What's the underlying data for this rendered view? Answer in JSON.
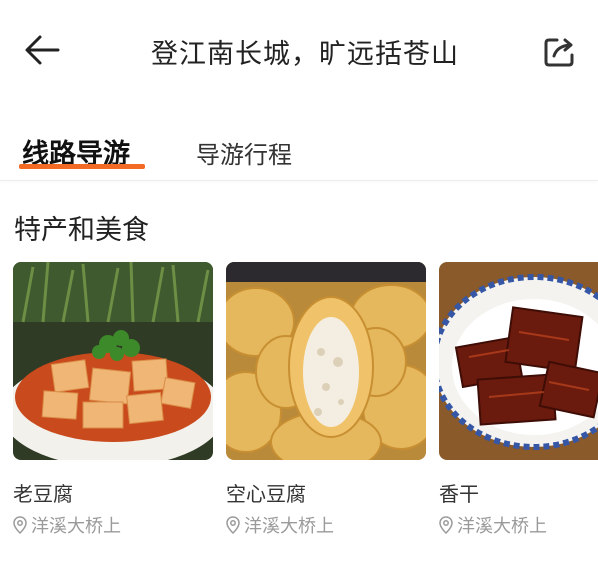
{
  "header": {
    "title": "登江南长城，旷远括苍山",
    "back_icon": "arrow-left-icon",
    "share_icon": "share-icon"
  },
  "tabs": [
    {
      "label": "线路导游",
      "active": true
    },
    {
      "label": "导游行程",
      "active": false
    }
  ],
  "accent_color": "#f26a24",
  "section": {
    "title": "特产和美食",
    "items": [
      {
        "name": "老豆腐",
        "location": "洋溪大桥上"
      },
      {
        "name": "空心豆腐",
        "location": "洋溪大桥上"
      },
      {
        "name": "香干",
        "location": "洋溪大桥上"
      }
    ]
  }
}
